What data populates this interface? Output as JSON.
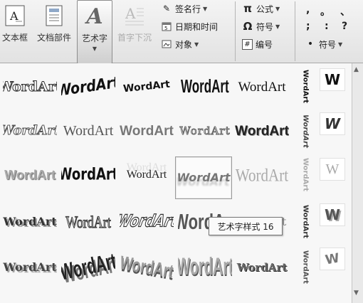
{
  "ribbon": {
    "text_box": {
      "label": "文本框",
      "icon": "text-box-icon"
    },
    "quick_parts": {
      "label": "文档部件",
      "icon": "quick-parts-icon"
    },
    "wordart": {
      "label": "艺术字",
      "icon": "wordart-icon",
      "glyph": "A"
    },
    "drop_cap": {
      "label": "首字下沉",
      "icon": "drop-cap-icon"
    },
    "insert_small": [
      {
        "label": "签名行",
        "icon": "signature-line-icon",
        "dropdown": true
      },
      {
        "label": "日期和时间",
        "icon": "date-time-icon",
        "dropdown": false
      },
      {
        "label": "对象",
        "icon": "object-icon",
        "dropdown": true
      }
    ],
    "symbols_small": [
      {
        "label": "公式",
        "icon": "equation-icon",
        "glyph": "π",
        "dropdown": true
      },
      {
        "label": "符号",
        "icon": "symbol-icon",
        "glyph": "Ω",
        "dropdown": true
      },
      {
        "label": "编号",
        "icon": "number-icon",
        "glyph": "#",
        "dropdown": false
      }
    ],
    "punctuation": [
      ",",
      "。",
      "、",
      ";",
      ":",
      "?"
    ],
    "special_symbol": {
      "label": "符号",
      "icon": "special-symbol-icon",
      "glyph": "•"
    }
  },
  "gallery": {
    "sample_text": "WordArt",
    "vertical_text": "WordArt",
    "side_letter": "W",
    "selected_style": 16,
    "tooltip": "艺术字样式 16"
  },
  "colors": {
    "ribbon_bg": "#e8e8e8",
    "gallery_bg": "#f7f7f7",
    "tooltip_border": "#767676"
  }
}
